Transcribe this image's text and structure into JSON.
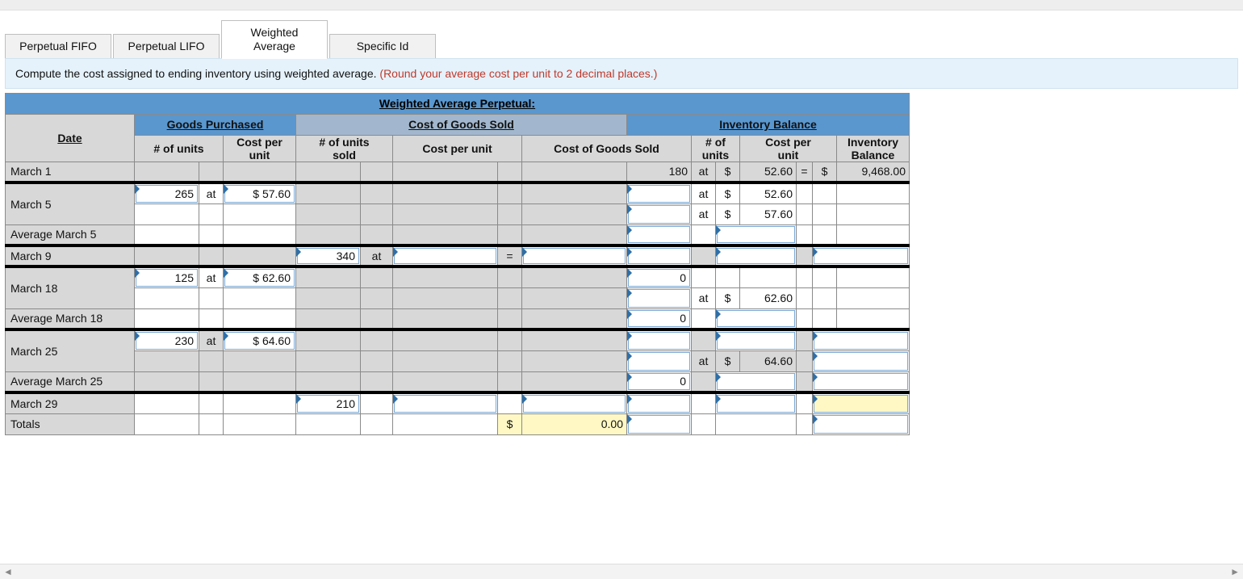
{
  "tabs": {
    "fifo": "Perpetual FIFO",
    "lifo": "Perpetual LIFO",
    "wavg_line1": "Weighted",
    "wavg_line2": "Average",
    "specific": "Specific Id"
  },
  "instruction": {
    "main": "Compute the cost assigned to ending inventory using weighted average. ",
    "note": "(Round your average cost per unit to 2 decimal places.)"
  },
  "table": {
    "title": "Weighted Average Perpetual:",
    "sections": {
      "date": "Date",
      "goods_purchased": "Goods Purchased",
      "cogs": "Cost of Goods Sold",
      "inventory": "Inventory Balance"
    },
    "subheaders": {
      "units": "# of units",
      "cost_per_unit": "Cost per\nunit",
      "units_sold": "# of units\nsold",
      "cost_per_unit_flat": "Cost per unit",
      "cogs": "Cost of Goods Sold",
      "inv_balance": "Inventory Balance"
    },
    "labels": {
      "at": "at",
      "eq": "=",
      "dollar": "$"
    },
    "rows": {
      "march1": {
        "date": "March 1",
        "inv_units": "180",
        "inv_cpu": "52.60",
        "inv_balance": "9,468.00"
      },
      "march5": {
        "date": "March 5",
        "gp_units": "265",
        "gp_cpu": "$ 57.60",
        "inv_cpu_a": "52.60",
        "inv_cpu_b": "57.60"
      },
      "avg_march5": {
        "date": "Average March 5"
      },
      "march9": {
        "date": "March 9",
        "cogs_units": "340"
      },
      "march18": {
        "date": "March 18",
        "gp_units": "125",
        "gp_cpu": "$ 62.60",
        "inv_units_a": "0",
        "inv_cpu_b": "62.60"
      },
      "avg_march18": {
        "date": "Average March 18",
        "inv_units": "0"
      },
      "march25": {
        "date": "March 25",
        "gp_units": "230",
        "gp_cpu": "$ 64.60",
        "inv_cpu_b": "64.60"
      },
      "avg_march25": {
        "date": "Average March 25",
        "inv_units": "0"
      },
      "march29": {
        "date": "March 29",
        "cogs_units": "210"
      },
      "totals": {
        "date": "Totals",
        "cogs_total": "0.00"
      }
    }
  },
  "scroll": {
    "left": "◄",
    "right": "►"
  }
}
